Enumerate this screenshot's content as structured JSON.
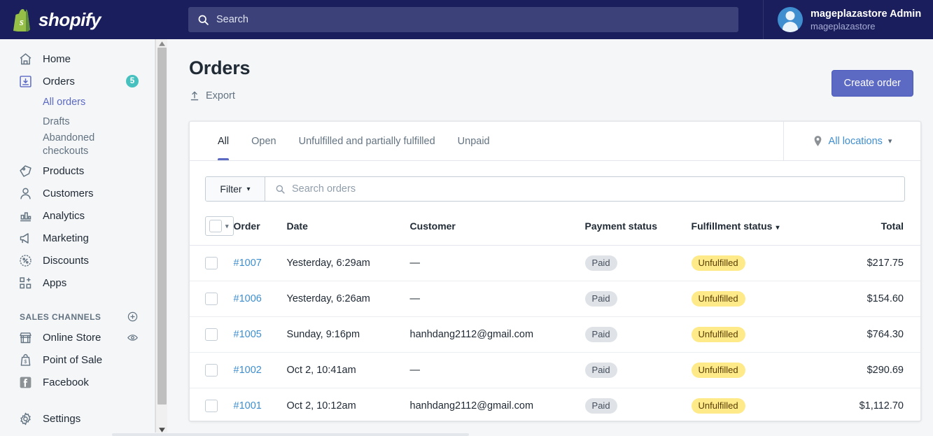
{
  "topbar": {
    "logo_text": "shopify",
    "logo_icon": "shopify-bag-logo",
    "search": {
      "placeholder": "Search",
      "value": "",
      "icon": "search-icon"
    },
    "user": {
      "name": "mageplazastore Admin",
      "store": "mageplazastore",
      "avatar_icon": "user-avatar-icon"
    },
    "bg_color": "#1a1e5c",
    "search_bg_color": "#3c4279"
  },
  "sidebar": {
    "items": [
      {
        "label": "Home",
        "icon": "home-icon",
        "badge": ""
      },
      {
        "label": "Orders",
        "icon": "orders-inbox-icon",
        "badge": "5"
      },
      {
        "label": "Products",
        "icon": "tag-icon",
        "badge": ""
      },
      {
        "label": "Customers",
        "icon": "person-icon",
        "badge": ""
      },
      {
        "label": "Analytics",
        "icon": "bar-chart-icon",
        "badge": ""
      },
      {
        "label": "Marketing",
        "icon": "megaphone-icon",
        "badge": ""
      },
      {
        "label": "Discounts",
        "icon": "discount-percent-icon",
        "badge": ""
      },
      {
        "label": "Apps",
        "icon": "apps-grid-plus-icon",
        "badge": ""
      }
    ],
    "sub_items": [
      {
        "label": "All orders",
        "active": true
      },
      {
        "label": "Drafts",
        "active": false
      },
      {
        "label": "Abandoned checkouts",
        "active": false
      }
    ],
    "section_title": "SALES CHANNELS",
    "section_add_icon": "plus-circle-icon",
    "channels": [
      {
        "label": "Online Store",
        "icon": "storefront-icon",
        "trailing_icon": "eye-icon"
      },
      {
        "label": "Point of Sale",
        "icon": "pos-bag-icon",
        "trailing_icon": ""
      },
      {
        "label": "Facebook",
        "icon": "facebook-icon",
        "trailing_icon": ""
      }
    ],
    "settings": {
      "label": "Settings",
      "icon": "gear-icon"
    },
    "badge_color": "#47c1bf",
    "active_color": "#5c6ac4"
  },
  "main": {
    "page_title": "Orders",
    "export": {
      "label": "Export",
      "icon": "upload-icon"
    },
    "create_order_label": "Create order",
    "primary_color": "#5c6ac4",
    "tabs": [
      {
        "label": "All",
        "active": true
      },
      {
        "label": "Open",
        "active": false
      },
      {
        "label": "Unfulfilled and partially fulfilled",
        "active": false
      },
      {
        "label": "Unpaid",
        "active": false
      }
    ],
    "locations": {
      "label": "All locations",
      "icon": "location-pin-icon",
      "caret": "▾"
    },
    "filter": {
      "label": "Filter",
      "caret": "▾"
    },
    "search_orders": {
      "placeholder": "Search orders",
      "value": "",
      "icon": "search-icon"
    },
    "table": {
      "select_all_caret": "▾",
      "columns": [
        {
          "key": "order",
          "label": "Order"
        },
        {
          "key": "date",
          "label": "Date"
        },
        {
          "key": "customer",
          "label": "Customer"
        },
        {
          "key": "payment",
          "label": "Payment status"
        },
        {
          "key": "fulfillment",
          "label": "Fulfillment status",
          "sorted": true,
          "caret": "▾"
        },
        {
          "key": "total",
          "label": "Total"
        }
      ],
      "rows": [
        {
          "order": "#1007",
          "date": "Yesterday, 6:29am",
          "customer": "—",
          "payment": "Paid",
          "fulfillment": "Unfulfilled",
          "total": "$217.75"
        },
        {
          "order": "#1006",
          "date": "Yesterday, 6:26am",
          "customer": "—",
          "payment": "Paid",
          "fulfillment": "Unfulfilled",
          "total": "$154.60"
        },
        {
          "order": "#1005",
          "date": "Sunday, 9:16pm",
          "customer": "hanhdang2112@gmail.com",
          "payment": "Paid",
          "fulfillment": "Unfulfilled",
          "total": "$764.30"
        },
        {
          "order": "#1002",
          "date": "Oct 2, 10:41am",
          "customer": "—",
          "payment": "Paid",
          "fulfillment": "Unfulfilled",
          "total": "$290.69"
        },
        {
          "order": "#1001",
          "date": "Oct 2, 10:12am",
          "customer": "hanhdang2112@gmail.com",
          "payment": "Paid",
          "fulfillment": "Unfulfilled",
          "total": "$1,112.70"
        }
      ],
      "paid_badge_color": "#dfe3e8",
      "unfulfilled_badge_color": "#ffea8a",
      "link_color": "#3e8ed0"
    }
  }
}
